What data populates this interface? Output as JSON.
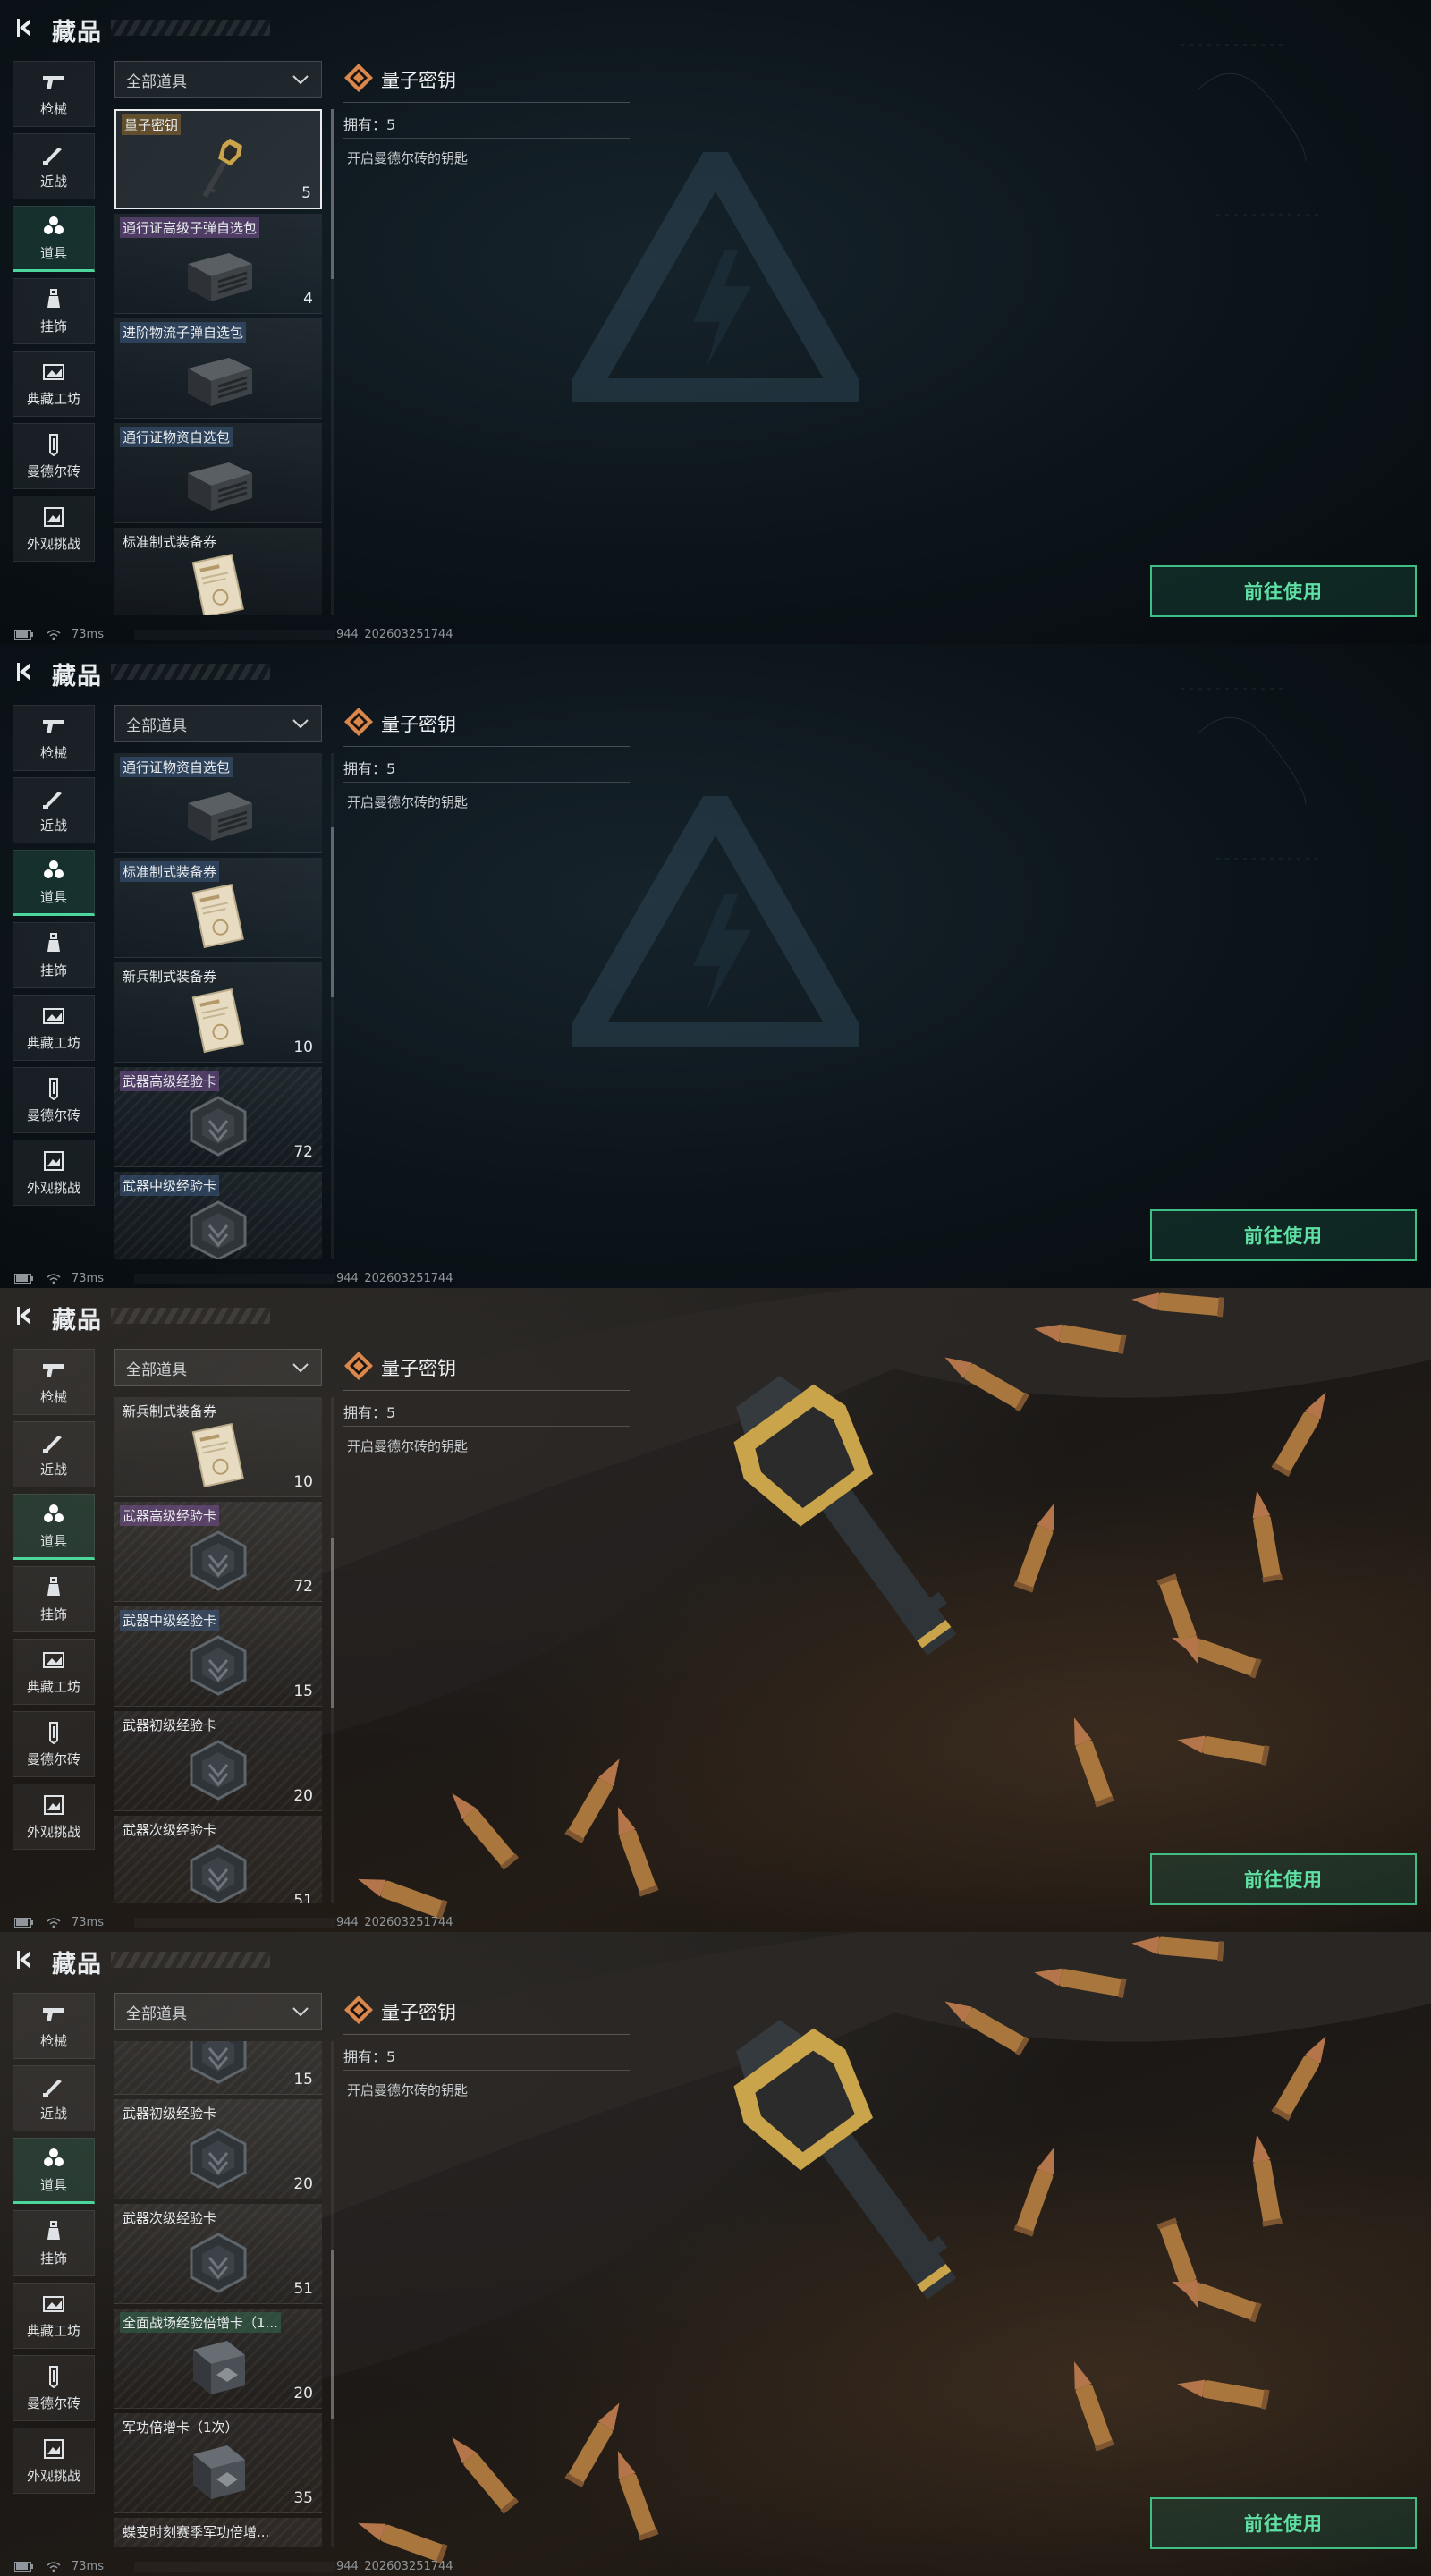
{
  "page": {
    "title": "藏品",
    "filter_label": "全部道具",
    "use_button_label": "前往使用"
  },
  "nav": [
    {
      "label": "枪械",
      "icon": "pistol-icon",
      "active": false
    },
    {
      "label": "近战",
      "icon": "knife-icon",
      "active": false
    },
    {
      "label": "道具",
      "icon": "items-icon",
      "active": true
    },
    {
      "label": "挂饰",
      "icon": "charm-icon",
      "active": false
    },
    {
      "label": "典藏工坊",
      "icon": "workshop-icon",
      "active": false
    },
    {
      "label": "曼德尔砖",
      "icon": "brick-icon",
      "active": false
    },
    {
      "label": "外观挑战",
      "icon": "challenge-icon",
      "active": false
    }
  ],
  "detail": {
    "item_name": "量子密钥",
    "owned_text": "拥有：5",
    "description": "开启曼德尔砖的钥匙"
  },
  "status": {
    "ping": "73ms",
    "build": "944_202603251744"
  },
  "colors": {
    "accent": "#4cd69b",
    "use_button_border": "#3fbf85",
    "detail_icon": "#d9874a"
  },
  "frames": [
    {
      "background": "dark",
      "scroll_position": 0.0,
      "items": [
        {
          "name": "量子密钥",
          "count": "5",
          "quality": "gold",
          "icon": "key-icon",
          "selected": true
        },
        {
          "name": "通行证高级子弹自选包",
          "count": "4",
          "quality": "purple",
          "icon": "ammo-crate-icon",
          "selected": false
        },
        {
          "name": "进阶物流子弹自选包",
          "count": "",
          "quality": "blue",
          "icon": "ammo-crate-icon",
          "selected": false
        },
        {
          "name": "通行证物资自选包",
          "count": "",
          "quality": "blue",
          "icon": "ammo-crate-icon",
          "selected": false
        },
        {
          "name": "标准制式装备券",
          "count": "",
          "quality": "none",
          "icon": "voucher-icon",
          "selected": false
        }
      ]
    },
    {
      "background": "dark",
      "scroll_position": 0.22,
      "items": [
        {
          "name": "通行证物资自选包",
          "count": "",
          "quality": "blue",
          "icon": "ammo-crate-icon",
          "selected": false
        },
        {
          "name": "标准制式装备券",
          "count": "",
          "quality": "blue",
          "icon": "voucher-icon",
          "selected": false
        },
        {
          "name": "新兵制式装备券",
          "count": "10",
          "quality": "none",
          "icon": "voucher-icon",
          "selected": false
        },
        {
          "name": "武器高级经验卡",
          "count": "72",
          "quality": "purple",
          "icon": "exp-card-icon",
          "selected": false
        },
        {
          "name": "武器中级经验卡",
          "count": "",
          "quality": "blue",
          "icon": "exp-card-icon",
          "selected": false
        }
      ]
    },
    {
      "background": "photo",
      "scroll_position": 0.42,
      "items": [
        {
          "name": "新兵制式装备券",
          "count": "10",
          "quality": "none",
          "icon": "voucher-icon",
          "selected": false
        },
        {
          "name": "武器高级经验卡",
          "count": "72",
          "quality": "purple",
          "icon": "exp-card-icon",
          "selected": false
        },
        {
          "name": "武器中级经验卡",
          "count": "15",
          "quality": "blue",
          "icon": "exp-card-icon",
          "selected": false
        },
        {
          "name": "武器初级经验卡",
          "count": "20",
          "quality": "none",
          "icon": "exp-card-icon",
          "selected": false
        },
        {
          "name": "武器次级经验卡",
          "count": "51",
          "quality": "none",
          "icon": "exp-card-icon",
          "selected": false
        }
      ]
    },
    {
      "background": "photo",
      "scroll_position": 0.62,
      "items": [
        {
          "name": "",
          "count": "15",
          "quality": "none",
          "icon": "exp-card-icon",
          "selected": false
        },
        {
          "name": "武器初级经验卡",
          "count": "20",
          "quality": "none",
          "icon": "exp-card-icon",
          "selected": false
        },
        {
          "name": "武器次级经验卡",
          "count": "51",
          "quality": "none",
          "icon": "exp-card-icon",
          "selected": false
        },
        {
          "name": "全面战场经验倍增卡（1...",
          "count": "20",
          "quality": "green",
          "icon": "boost-card-icon",
          "selected": false
        },
        {
          "name": "军功倍增卡（1次）",
          "count": "35",
          "quality": "none",
          "icon": "boost-card-icon",
          "selected": false
        },
        {
          "name": "蝶变时刻赛季军功倍增...",
          "count": "",
          "quality": "none",
          "icon": "boost-card-icon",
          "selected": false
        }
      ]
    }
  ]
}
